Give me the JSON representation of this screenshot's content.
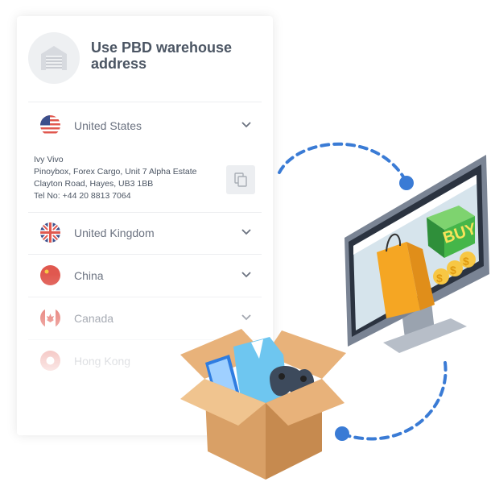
{
  "card": {
    "title": "Use PBD warehouse address",
    "header_icon": "warehouse-icon",
    "countries": [
      {
        "name": "United States",
        "flag": "us-flag-icon",
        "expanded": true
      },
      {
        "name": "United Kingdom",
        "flag": "uk-flag-icon",
        "expanded": false
      },
      {
        "name": "China",
        "flag": "china-flag-icon",
        "expanded": false
      },
      {
        "name": "Canada",
        "flag": "canada-flag-icon",
        "expanded": false
      },
      {
        "name": "Hong Kong",
        "flag": "hong-kong-flag-icon",
        "expanded": false
      }
    ],
    "address": {
      "line1": "Ivy Vivo",
      "line2": "Pinoybox, Forex Cargo, Unit 7 Alpha Estate",
      "line3": "Clayton Road, Hayes, UB3 1BB",
      "line4": "Tel No: +44 20 8813 7064"
    },
    "copy_icon": "copy-icon"
  },
  "illustration": {
    "monitor_text": "BUY",
    "colors": {
      "accent_blue": "#3a7bd5",
      "monitor_frame": "#7a8494",
      "screen_bg": "#d6e4ec",
      "bag": "#f5a623",
      "buy_box": "#45b649",
      "coin": "#f7c744",
      "box": "#d9a066"
    }
  }
}
